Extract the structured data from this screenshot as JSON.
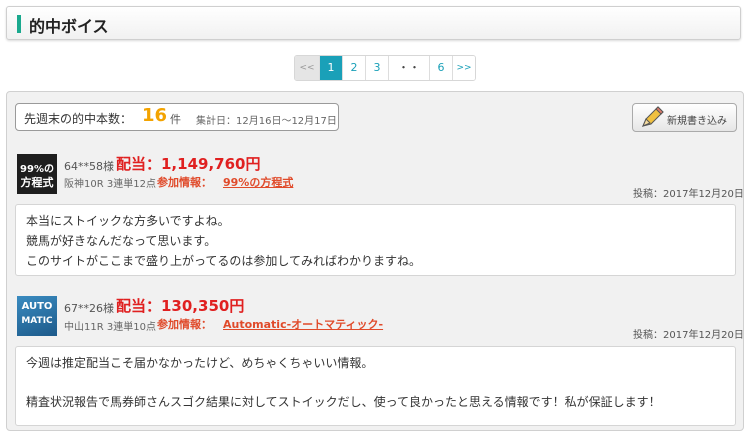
{
  "header": {
    "title": "的中ボイス"
  },
  "pagination": {
    "prev": "<<",
    "pages": [
      "1",
      "2",
      "3"
    ],
    "dots": "・・",
    "last": "6",
    "next": ">>"
  },
  "summary": {
    "label": "先週末の的中本数：",
    "count": "16",
    "unit": "件",
    "period": "集計日：12月16日〜12月17日",
    "new_post_label": "新規書き込み"
  },
  "entries": [
    {
      "thumb_text": [
        "99%の",
        "方程式"
      ],
      "user": "64**58様",
      "payout": "配当：1,149,760円",
      "race": "阪神10R 3連単12点",
      "info_label": "参加情報：",
      "info_link": "99%の方程式",
      "date": "投稿：2017年12月20日",
      "comment": [
        "本当にストイックな方多いですよね。",
        "競馬が好きなんだなって思います。",
        "このサイトがここまで盛り上がってるのは参加してみればわかりますね。"
      ]
    },
    {
      "thumb_text": [
        "AUTO",
        "MATIC"
      ],
      "user": "67**26様",
      "payout": "配当：130,350円",
      "race": "中山11R 3連単10点",
      "info_label": "参加情報：",
      "info_link": "Automatic-オートマティック-",
      "date": "投稿：2017年12月20日",
      "comment": [
        "今週は推定配当こそ届かなかったけど、めちゃくちゃいい情報。",
        "",
        "精査状況報告で馬券師さんスゴク結果に対してストイックだし、使って良かったと思える情報です！私が保証します！"
      ]
    }
  ],
  "colors": {
    "accent": "#1aa98e",
    "pager_active": "#1aa0b8",
    "count": "#f3a300",
    "payout": "#e02020",
    "link": "#e04a2a"
  }
}
